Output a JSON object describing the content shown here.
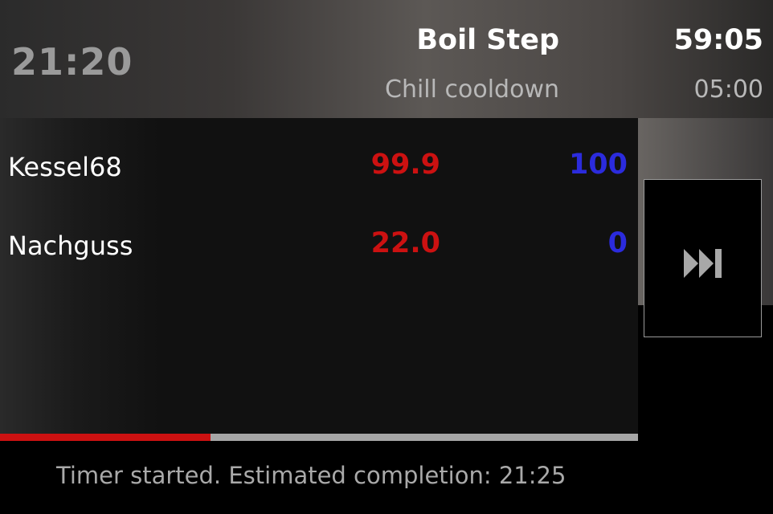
{
  "header": {
    "clock": "21:20",
    "current_step": "Boil Step",
    "current_step_time": "59:05",
    "next_step": "Chill cooldown",
    "next_step_time": "05:00"
  },
  "vessels": [
    {
      "name": "Kessel68",
      "temperature": "99.9",
      "target": "100"
    },
    {
      "name": "Nachguss",
      "temperature": "22.0",
      "target": "0"
    }
  ],
  "progress": {
    "fraction": 0.33
  },
  "status": "Timer started. Estimated completion: 21:25",
  "controls": {
    "skip_icon": "fast-forward-icon"
  },
  "colors": {
    "temperature": "#cc1111",
    "target": "#2b2bdd",
    "progress": "#cc1111",
    "progress_track": "#a6a6a6"
  }
}
